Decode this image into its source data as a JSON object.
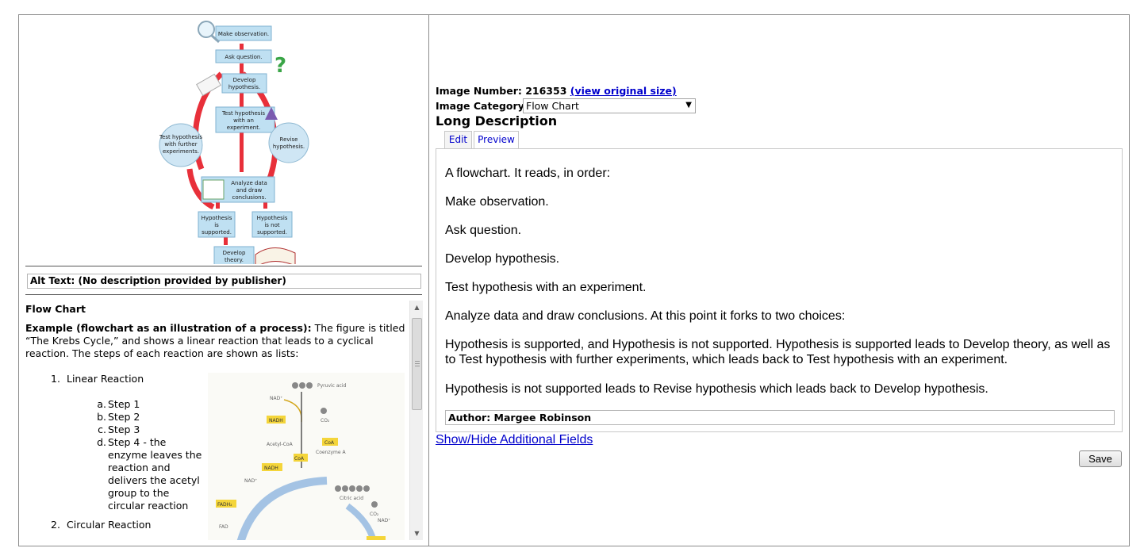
{
  "figure": {
    "steps": {
      "make_observation": "Make observation.",
      "ask_question": "Ask question.",
      "develop_hypothesis": [
        "Develop",
        "hypothesis."
      ],
      "test_experiment": [
        "Test hypothesis",
        "with an",
        "experiment."
      ],
      "test_further": [
        "Test hypothesis",
        "with further",
        "experiments."
      ],
      "revise": [
        "Revise",
        "hypothesis."
      ],
      "analyze": [
        "Analyze data",
        "and draw",
        "conclusions."
      ],
      "supported": [
        "Hypothesis",
        "is",
        "supported."
      ],
      "not_supported": [
        "Hypothesis",
        "is not",
        "supported."
      ],
      "develop_theory": [
        "Develop",
        "theory."
      ]
    },
    "colors": {
      "box": "#bfe0f2",
      "arrow": "#e8303a",
      "circle": "#cfe6f4"
    }
  },
  "alt_text": "Alt Text: (No description provided by publisher)",
  "guide": {
    "heading": "Flow Chart",
    "example_label": "Example (flowchart as an illustration of a process):",
    "example_text": " The figure is titled “The Krebs Cycle,” and shows a linear reaction that leads to a cyclical reaction. The steps of each reaction are shown as lists:",
    "items": [
      {
        "num": "1.",
        "label": "Linear Reaction"
      },
      {
        "num": "2.",
        "label": "Circular Reaction"
      }
    ],
    "sub_items": [
      {
        "mark": "a.",
        "text": "Step 1"
      },
      {
        "mark": "b.",
        "text": "Step 2"
      },
      {
        "mark": "c.",
        "text": "Step 3"
      },
      {
        "mark": "d.",
        "text": "Step 4 - the enzyme leaves the reaction and delivers the acetyl group to the circular reaction"
      }
    ],
    "krebs_labels": {
      "pyruvic": "Pyruvic acid",
      "nad1": "NAD⁺",
      "nadh1": "NADH",
      "co2": "CO₂",
      "acetyl": "Acetyl-CoA",
      "coa": "CoA",
      "coenzyme": "Coenzyme A",
      "nadh2": "NADH",
      "nad2": "NAD⁺",
      "citric": "Citric acid",
      "fadh2": "FADH₂",
      "fad": "FAD",
      "co2b": "CO₂",
      "nad3": "NAD⁺"
    }
  },
  "right": {
    "image_number_label": "Image Number: 216353",
    "view_original": "(view original size)",
    "category_label": "Image Category:",
    "category_value": "Flow Chart",
    "long_description_title": "Long Description",
    "tabs": {
      "edit": "Edit",
      "preview": "Preview"
    },
    "description": [
      "A flowchart. It reads, in order:",
      "Make observation.",
      "Ask question.",
      "Develop hypothesis.",
      "Test hypothesis with an experiment.",
      "Analyze data and draw conclusions. At this point it forks to two choices:",
      "Hypothesis is supported, and Hypothesis is not supported. Hypothesis is supported leads to Develop theory, as well as to Test hypothesis with further experiments, which leads back to Test hypothesis with an experiment.",
      "Hypothesis is not supported leads to Revise hypothesis which leads back to Develop hypothesis."
    ],
    "author": "Author: Margee Robinson",
    "show_hide": "Show/Hide Additional Fields",
    "save": "Save"
  }
}
